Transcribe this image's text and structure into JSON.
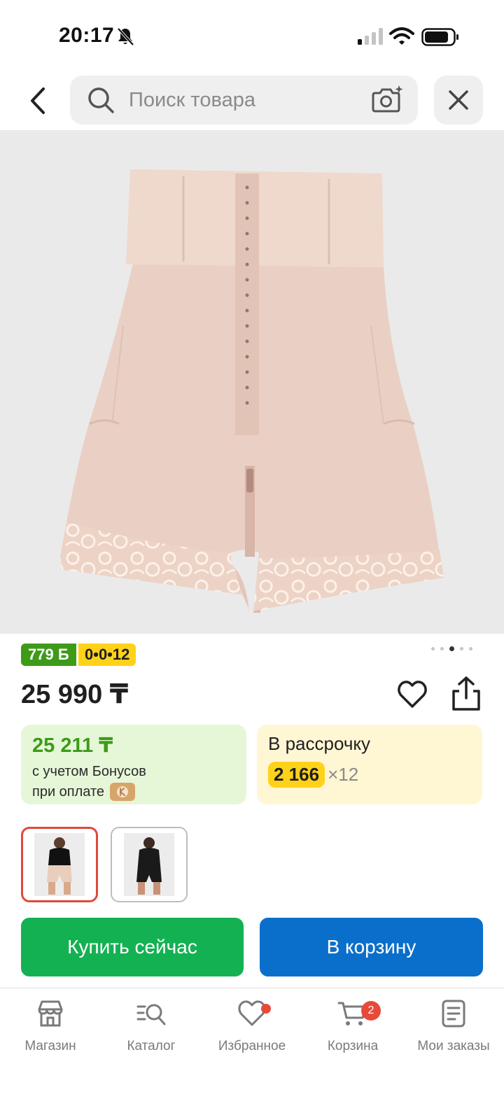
{
  "status_bar": {
    "time": "20:17"
  },
  "search": {
    "placeholder": "Поиск товара"
  },
  "badges": {
    "bonus": "779 Б",
    "installment": "0•0•12"
  },
  "gallery": {
    "total_images": 5,
    "active_index": 3
  },
  "price": "25 990 ₸",
  "bonus_card": {
    "amount": "25 211 ₸",
    "line1": "с учетом Бонусов",
    "line2": "при оплате"
  },
  "installment_card": {
    "title": "В рассрочку",
    "monthly": "2 166",
    "months": "×12"
  },
  "actions": {
    "buy_now": "Купить сейчас",
    "add_to_cart": "В корзину"
  },
  "nav": {
    "items": [
      {
        "label": "Магазин",
        "icon": "store-icon"
      },
      {
        "label": "Каталог",
        "icon": "catalog-search-icon"
      },
      {
        "label": "Избранное",
        "icon": "heart-icon"
      },
      {
        "label": "Корзина",
        "icon": "cart-icon"
      },
      {
        "label": "Мои заказы",
        "icon": "orders-icon"
      }
    ],
    "cart_count": "2"
  },
  "colors": {
    "green": "#3d9b18",
    "buy": "#14b152",
    "cart": "#0a6fcb",
    "yellow": "#ffd21a",
    "badge_red": "#e84a3a"
  }
}
